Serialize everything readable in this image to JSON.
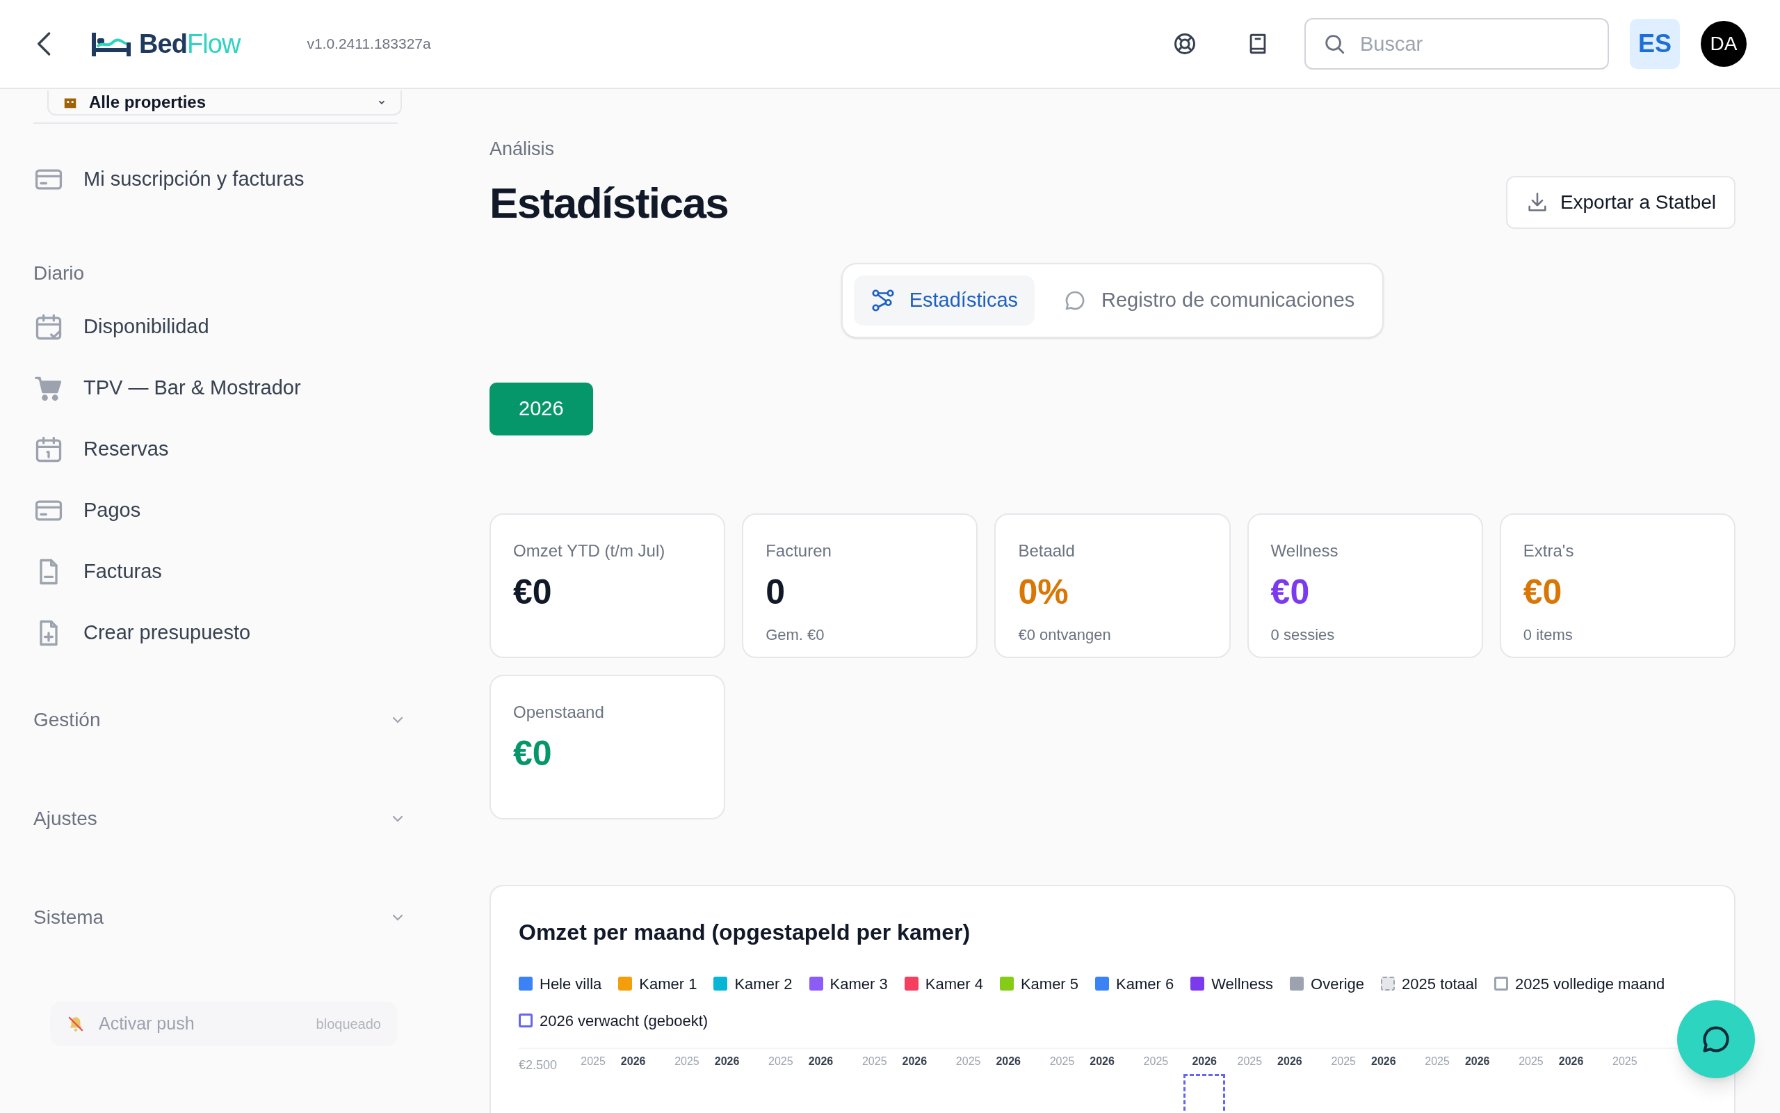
{
  "header": {
    "version": "v1.0.2411.183327a",
    "search": {
      "placeholder": "Buscar"
    },
    "language": "ES",
    "avatar": "DA"
  },
  "logo": {
    "part1": "Bed",
    "part2": "Flow"
  },
  "sidebar": {
    "property_select": "Alle properties",
    "top_items": [
      {
        "label": "Mi suscripción y facturas"
      }
    ],
    "sections": [
      {
        "title": "Diario",
        "items": [
          {
            "label": "Disponibilidad"
          },
          {
            "label": "TPV — Bar & Mostrador"
          },
          {
            "label": "Reservas"
          },
          {
            "label": "Pagos"
          },
          {
            "label": "Facturas"
          },
          {
            "label": "Crear presupuesto"
          }
        ]
      }
    ],
    "groups": [
      {
        "title": "Gestión",
        "expanded": false
      },
      {
        "title": "Ajustes",
        "expanded": false
      },
      {
        "title": "Sistema",
        "expanded": false
      }
    ],
    "push": {
      "label": "Activar push",
      "status": "bloqueado"
    }
  },
  "page": {
    "breadcrumb": "Análisis",
    "title": "Estadísticas",
    "export_button": "Exportar a Statbel",
    "tabs": [
      {
        "label": "Estadísticas",
        "selected": true
      },
      {
        "label": "Registro de comunicaciones",
        "selected": false
      }
    ],
    "years": [
      {
        "label": "2026",
        "selected": true
      }
    ],
    "stats": [
      {
        "label": "Omzet YTD (t/m Jul)",
        "value": "€0",
        "color": "#111827"
      },
      {
        "label": "Facturen",
        "value": "0",
        "sub": "Gem. €0",
        "color": "#111827"
      },
      {
        "label": "Betaald",
        "value": "0%",
        "sub": "€0 ontvangen",
        "color": "#d97706"
      },
      {
        "label": "Wellness",
        "value": "€0",
        "sub": "0 sessies",
        "color": "#7c3aed"
      },
      {
        "label": "Extra's",
        "value": "€0",
        "sub": "0 items",
        "color": "#d97706"
      },
      {
        "label": "Openstaand",
        "value": "€0",
        "color": "#059669"
      }
    ],
    "chart": {
      "title": "Omzet per maand (opgestapeld per kamer)",
      "legend": [
        {
          "label": "Hele villa",
          "kind": "solid",
          "color": "#3b82f6"
        },
        {
          "label": "Kamer 1",
          "kind": "solid",
          "color": "#f59e0b"
        },
        {
          "label": "Kamer 2",
          "kind": "solid",
          "color": "#06b6d4"
        },
        {
          "label": "Kamer 3",
          "kind": "solid",
          "color": "#8b5cf6"
        },
        {
          "label": "Kamer 4",
          "kind": "solid",
          "color": "#f43f5e"
        },
        {
          "label": "Kamer 5",
          "kind": "solid",
          "color": "#84cc16"
        },
        {
          "label": "Kamer 6",
          "kind": "solid",
          "color": "#3b82f6"
        },
        {
          "label": "Wellness",
          "kind": "solid",
          "color": "#7c3aed"
        },
        {
          "label": "Overige",
          "kind": "solid",
          "color": "#9ca3af"
        },
        {
          "label": "2025 totaal",
          "kind": "dashed",
          "color": "#9ca3af"
        },
        {
          "label": "2025 volledige maand",
          "kind": "outline",
          "color": "#9ca3af"
        },
        {
          "label": "2026 verwacht (geboekt)",
          "kind": "outline",
          "color": "#6366f1"
        }
      ],
      "y_tick": "€2.500",
      "month_labels": [
        {
          "labels": [
            "2025",
            "2026"
          ],
          "expected": false
        },
        {
          "labels": [
            "2025",
            "2026"
          ],
          "expected": false
        },
        {
          "labels": [
            "2025",
            "2026"
          ],
          "expected": false
        },
        {
          "labels": [
            "2025",
            "2026"
          ],
          "expected": false
        },
        {
          "labels": [
            "2025",
            "2026"
          ],
          "expected": false
        },
        {
          "labels": [
            "2025",
            "2026"
          ],
          "expected": false
        },
        {
          "labels": [
            "2025",
            "2026"
          ],
          "expected": true
        },
        {
          "labels": [
            "2025",
            "2026"
          ],
          "expected": false
        },
        {
          "labels": [
            "2025",
            "2026"
          ],
          "expected": false
        },
        {
          "labels": [
            "2025",
            "2026"
          ],
          "expected": false
        },
        {
          "labels": [
            "2025",
            "2026"
          ],
          "expected": false
        },
        {
          "labels": [
            "2025"
          ],
          "expected": false
        }
      ]
    }
  }
}
